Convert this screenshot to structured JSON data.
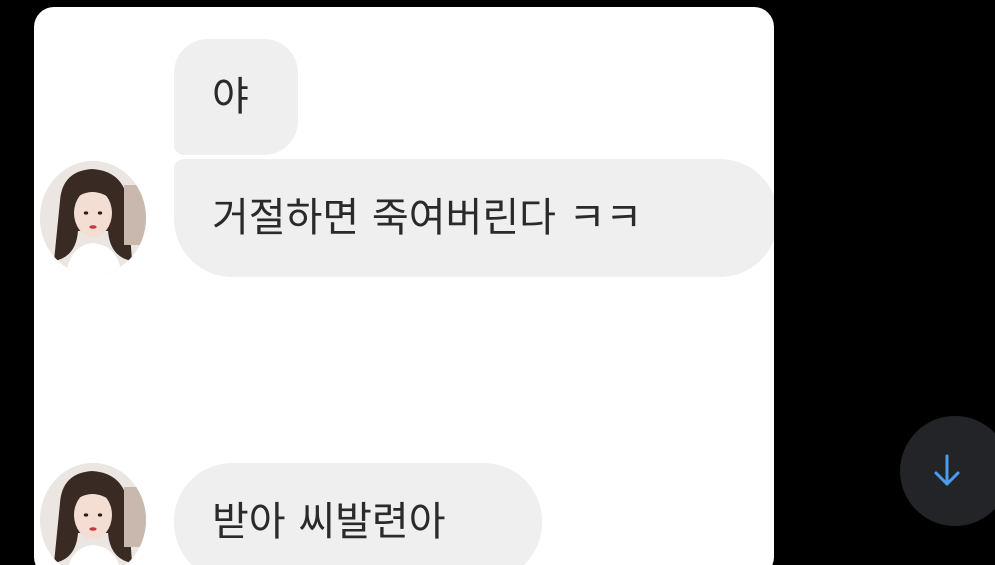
{
  "messages": [
    {
      "text": "야"
    },
    {
      "text": "거절하면 죽여버린다 ㅋㅋ"
    },
    {
      "text": "받아 씨발련아"
    }
  ],
  "icons": {
    "avatar": "profile-photo",
    "scroll_down": "arrow-down-icon"
  },
  "colors": {
    "background": "#000000",
    "bubble": "#efefef",
    "bubble_text": "#2a2a2a",
    "scroll_button": "#222427",
    "scroll_arrow": "#4b9df2"
  }
}
